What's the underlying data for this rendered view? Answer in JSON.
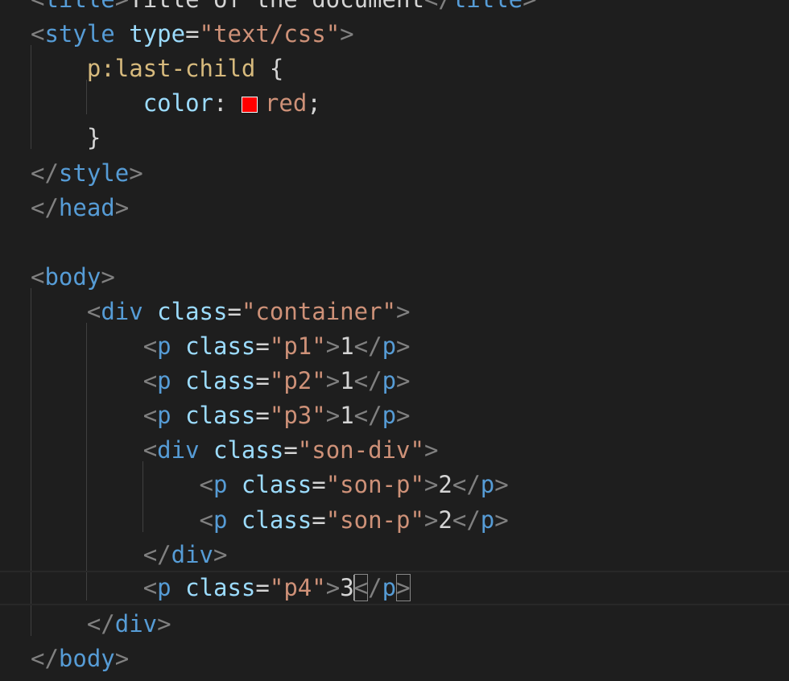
{
  "editor": {
    "language": "html",
    "swatch_color": "#ff0000",
    "lines": [
      {
        "id": "title",
        "tokens": [
          {
            "t": "punct",
            "v": "<"
          },
          {
            "t": "tag",
            "v": "title"
          },
          {
            "t": "punct",
            "v": ">"
          },
          {
            "t": "text",
            "v": "Title of the document"
          },
          {
            "t": "punct",
            "v": "</"
          },
          {
            "t": "tag",
            "v": "title"
          },
          {
            "t": "punct",
            "v": ">"
          }
        ]
      },
      {
        "id": "style-open",
        "tokens": [
          {
            "t": "punct",
            "v": "<"
          },
          {
            "t": "tag",
            "v": "style"
          },
          {
            "t": "text",
            "v": " "
          },
          {
            "t": "attr",
            "v": "type"
          },
          {
            "t": "text",
            "v": "="
          },
          {
            "t": "str",
            "v": "\"text/css\""
          },
          {
            "t": "punct",
            "v": ">"
          }
        ]
      },
      {
        "id": "selector",
        "tokens": [
          {
            "t": "text",
            "v": "    "
          },
          {
            "t": "sel",
            "v": "p:last-child"
          },
          {
            "t": "text",
            "v": " {"
          }
        ]
      },
      {
        "id": "declaration",
        "tokens": [
          {
            "t": "text",
            "v": "        "
          },
          {
            "t": "prop",
            "v": "color"
          },
          {
            "t": "text",
            "v": ": "
          },
          {
            "t": "swatch",
            "v": ""
          },
          {
            "t": "val",
            "v": "red"
          },
          {
            "t": "text",
            "v": ";"
          }
        ]
      },
      {
        "id": "rule-close",
        "tokens": [
          {
            "t": "text",
            "v": "    }"
          }
        ]
      },
      {
        "id": "style-close",
        "tokens": [
          {
            "t": "punct",
            "v": "</"
          },
          {
            "t": "tag",
            "v": "style"
          },
          {
            "t": "punct",
            "v": ">"
          }
        ]
      },
      {
        "id": "head-close",
        "tokens": [
          {
            "t": "punct",
            "v": "</"
          },
          {
            "t": "tag",
            "v": "head"
          },
          {
            "t": "punct",
            "v": ">"
          }
        ]
      },
      {
        "id": "blank",
        "tokens": []
      },
      {
        "id": "body-open",
        "tokens": [
          {
            "t": "punct",
            "v": "<"
          },
          {
            "t": "tag",
            "v": "body"
          },
          {
            "t": "punct",
            "v": ">"
          }
        ]
      },
      {
        "id": "div-container",
        "tokens": [
          {
            "t": "text",
            "v": "    "
          },
          {
            "t": "punct",
            "v": "<"
          },
          {
            "t": "tag",
            "v": "div"
          },
          {
            "t": "text",
            "v": " "
          },
          {
            "t": "attr",
            "v": "class"
          },
          {
            "t": "text",
            "v": "="
          },
          {
            "t": "str",
            "v": "\"container\""
          },
          {
            "t": "punct",
            "v": ">"
          }
        ]
      },
      {
        "id": "p1",
        "tokens": [
          {
            "t": "text",
            "v": "        "
          },
          {
            "t": "punct",
            "v": "<"
          },
          {
            "t": "tag",
            "v": "p"
          },
          {
            "t": "text",
            "v": " "
          },
          {
            "t": "attr",
            "v": "class"
          },
          {
            "t": "text",
            "v": "="
          },
          {
            "t": "str",
            "v": "\"p1\""
          },
          {
            "t": "punct",
            "v": ">"
          },
          {
            "t": "text",
            "v": "1"
          },
          {
            "t": "punct",
            "v": "</"
          },
          {
            "t": "tag",
            "v": "p"
          },
          {
            "t": "punct",
            "v": ">"
          }
        ]
      },
      {
        "id": "p2",
        "tokens": [
          {
            "t": "text",
            "v": "        "
          },
          {
            "t": "punct",
            "v": "<"
          },
          {
            "t": "tag",
            "v": "p"
          },
          {
            "t": "text",
            "v": " "
          },
          {
            "t": "attr",
            "v": "class"
          },
          {
            "t": "text",
            "v": "="
          },
          {
            "t": "str",
            "v": "\"p2\""
          },
          {
            "t": "punct",
            "v": ">"
          },
          {
            "t": "text",
            "v": "1"
          },
          {
            "t": "punct",
            "v": "</"
          },
          {
            "t": "tag",
            "v": "p"
          },
          {
            "t": "punct",
            "v": ">"
          }
        ]
      },
      {
        "id": "p3",
        "tokens": [
          {
            "t": "text",
            "v": "        "
          },
          {
            "t": "punct",
            "v": "<"
          },
          {
            "t": "tag",
            "v": "p"
          },
          {
            "t": "text",
            "v": " "
          },
          {
            "t": "attr",
            "v": "class"
          },
          {
            "t": "text",
            "v": "="
          },
          {
            "t": "str",
            "v": "\"p3\""
          },
          {
            "t": "punct",
            "v": ">"
          },
          {
            "t": "text",
            "v": "1"
          },
          {
            "t": "punct",
            "v": "</"
          },
          {
            "t": "tag",
            "v": "p"
          },
          {
            "t": "punct",
            "v": ">"
          }
        ]
      },
      {
        "id": "div-son",
        "tokens": [
          {
            "t": "text",
            "v": "        "
          },
          {
            "t": "punct",
            "v": "<"
          },
          {
            "t": "tag",
            "v": "div"
          },
          {
            "t": "text",
            "v": " "
          },
          {
            "t": "attr",
            "v": "class"
          },
          {
            "t": "text",
            "v": "="
          },
          {
            "t": "str",
            "v": "\"son-div\""
          },
          {
            "t": "punct",
            "v": ">"
          }
        ]
      },
      {
        "id": "son-p-1",
        "tokens": [
          {
            "t": "text",
            "v": "            "
          },
          {
            "t": "punct",
            "v": "<"
          },
          {
            "t": "tag",
            "v": "p"
          },
          {
            "t": "text",
            "v": " "
          },
          {
            "t": "attr",
            "v": "class"
          },
          {
            "t": "text",
            "v": "="
          },
          {
            "t": "str",
            "v": "\"son-p\""
          },
          {
            "t": "punct",
            "v": ">"
          },
          {
            "t": "text",
            "v": "2"
          },
          {
            "t": "punct",
            "v": "</"
          },
          {
            "t": "tag",
            "v": "p"
          },
          {
            "t": "punct",
            "v": ">"
          }
        ]
      },
      {
        "id": "son-p-2",
        "tokens": [
          {
            "t": "text",
            "v": "            "
          },
          {
            "t": "punct",
            "v": "<"
          },
          {
            "t": "tag",
            "v": "p"
          },
          {
            "t": "text",
            "v": " "
          },
          {
            "t": "attr",
            "v": "class"
          },
          {
            "t": "text",
            "v": "="
          },
          {
            "t": "str",
            "v": "\"son-p\""
          },
          {
            "t": "punct",
            "v": ">"
          },
          {
            "t": "text",
            "v": "2"
          },
          {
            "t": "punct",
            "v": "</"
          },
          {
            "t": "tag",
            "v": "p"
          },
          {
            "t": "punct",
            "v": ">"
          }
        ]
      },
      {
        "id": "div-son-close",
        "tokens": [
          {
            "t": "text",
            "v": "        "
          },
          {
            "t": "punct",
            "v": "</"
          },
          {
            "t": "tag",
            "v": "div"
          },
          {
            "t": "punct",
            "v": ">"
          }
        ]
      },
      {
        "id": "p4",
        "active": true,
        "tokens": [
          {
            "t": "text",
            "v": "        "
          },
          {
            "t": "punct",
            "v": "<"
          },
          {
            "t": "tag",
            "v": "p"
          },
          {
            "t": "text",
            "v": " "
          },
          {
            "t": "attr",
            "v": "class"
          },
          {
            "t": "text",
            "v": "="
          },
          {
            "t": "str",
            "v": "\"p4\""
          },
          {
            "t": "punct",
            "v": ">"
          },
          {
            "t": "text",
            "v": "3"
          },
          {
            "t": "cursor",
            "v": ""
          },
          {
            "t": "punct",
            "v": "<",
            "match": true
          },
          {
            "t": "punct",
            "v": "/"
          },
          {
            "t": "tag",
            "v": "p"
          },
          {
            "t": "punct",
            "v": ">",
            "match": true
          }
        ]
      },
      {
        "id": "div-container-close",
        "tokens": [
          {
            "t": "text",
            "v": "    "
          },
          {
            "t": "punct",
            "v": "</"
          },
          {
            "t": "tag",
            "v": "div"
          },
          {
            "t": "punct",
            "v": ">"
          }
        ]
      },
      {
        "id": "body-close",
        "tokens": [
          {
            "t": "punct",
            "v": "</"
          },
          {
            "t": "tag",
            "v": "body"
          },
          {
            "t": "punct",
            "v": ">"
          }
        ]
      }
    ]
  }
}
